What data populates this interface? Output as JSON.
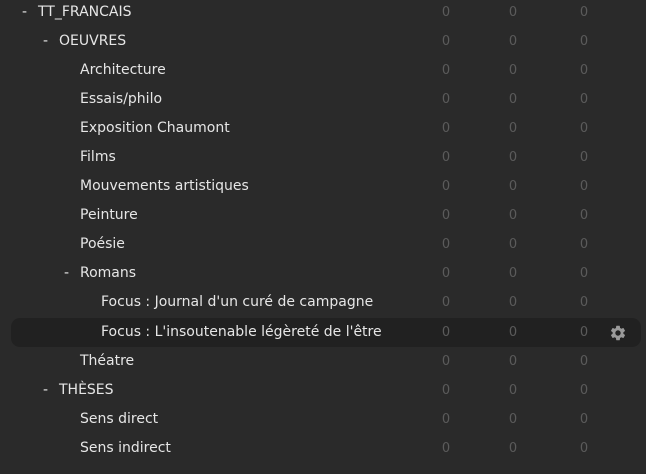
{
  "tree": {
    "rows": [
      {
        "toggle": "-",
        "label": "TT_FRANCAIS",
        "counts": [
          "0",
          "0",
          "0"
        ]
      },
      {
        "toggle": "-",
        "label": "OEUVRES",
        "counts": [
          "0",
          "0",
          "0"
        ]
      },
      {
        "label": "Architecture",
        "counts": [
          "0",
          "0",
          "0"
        ]
      },
      {
        "label": "Essais/philo",
        "counts": [
          "0",
          "0",
          "0"
        ]
      },
      {
        "label": "Exposition Chaumont",
        "counts": [
          "0",
          "0",
          "0"
        ]
      },
      {
        "label": "Films",
        "counts": [
          "0",
          "0",
          "0"
        ]
      },
      {
        "label": "Mouvements artistiques",
        "counts": [
          "0",
          "0",
          "0"
        ]
      },
      {
        "label": "Peinture",
        "counts": [
          "0",
          "0",
          "0"
        ]
      },
      {
        "label": "Poésie",
        "counts": [
          "0",
          "0",
          "0"
        ]
      },
      {
        "toggle": "-",
        "label": "Romans",
        "counts": [
          "0",
          "0",
          "0"
        ]
      },
      {
        "label": "Focus : Journal d'un curé de campagne",
        "counts": [
          "0",
          "0",
          "0"
        ]
      },
      {
        "label": "Focus : L'insoutenable légèreté de l'être",
        "counts": [
          "0",
          "0",
          "0"
        ],
        "gear_icon": "gear-icon"
      },
      {
        "label": "Théatre",
        "counts": [
          "0",
          "0",
          "0"
        ]
      },
      {
        "toggle": "-",
        "label": "THÈSES",
        "counts": [
          "0",
          "0",
          "0"
        ]
      },
      {
        "label": "Sens direct",
        "counts": [
          "0",
          "0",
          "0"
        ]
      },
      {
        "label": "Sens indirect",
        "counts": [
          "0",
          "0",
          "0"
        ]
      }
    ]
  },
  "colors": {
    "background": "#2a2a2a",
    "selected_row": "#212121",
    "text": "#e6e6e6",
    "count_text": "#5b5b5b",
    "gear": "#9a9a9a"
  }
}
